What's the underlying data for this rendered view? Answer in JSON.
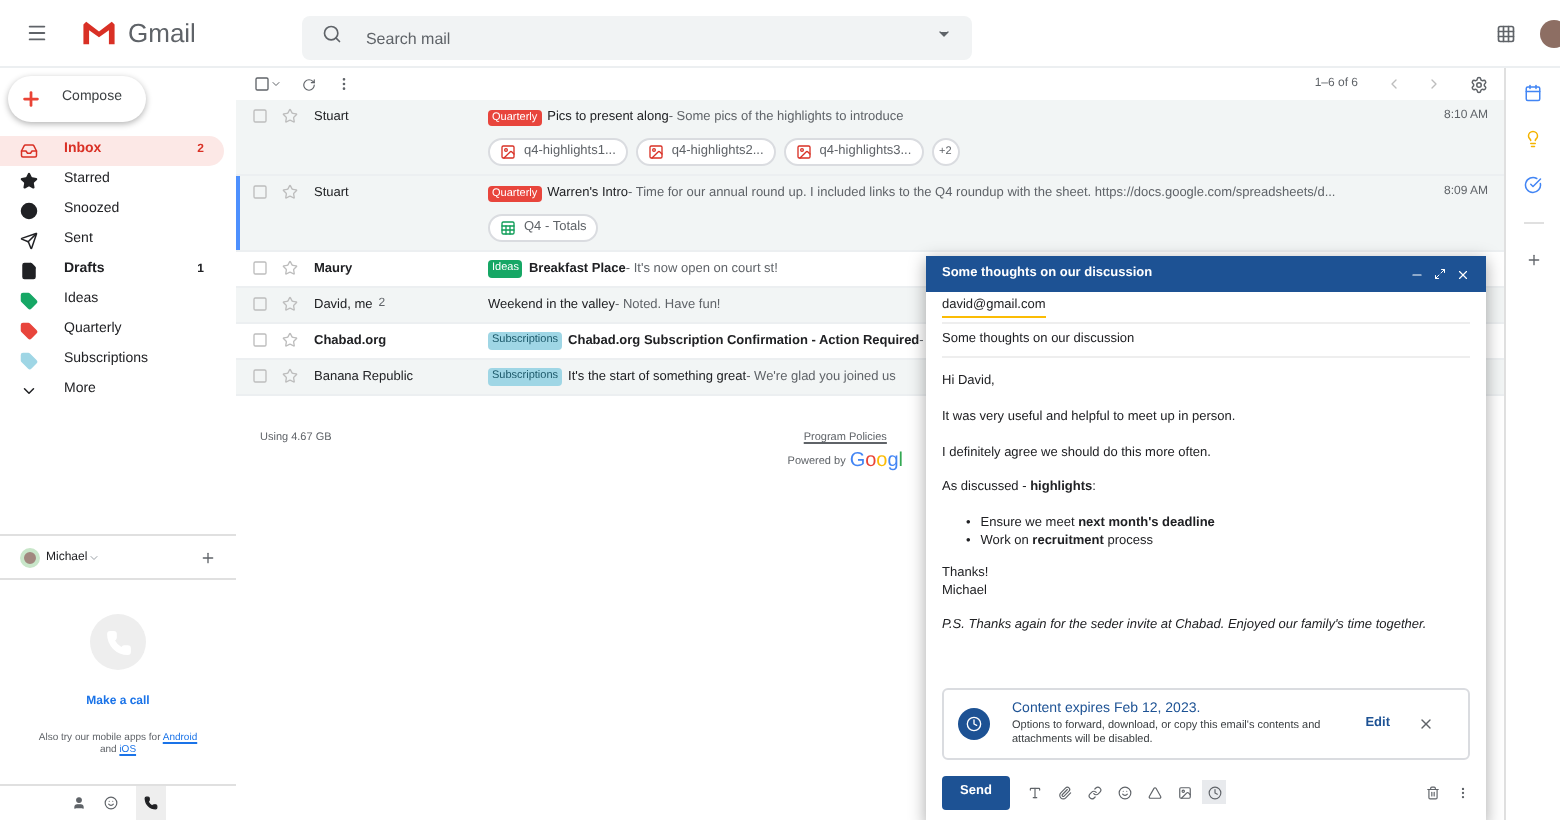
{
  "header": {
    "app_name": "Gmail",
    "search": {
      "placeholder": "Search mail"
    }
  },
  "sidebar": {
    "compose": "Compose",
    "items": [
      {
        "label": "Inbox",
        "count": "2",
        "selected": true,
        "bold": true
      },
      {
        "label": "Starred",
        "selected": false,
        "bold": false
      },
      {
        "label": "Snoozed",
        "selected": false,
        "bold": false
      },
      {
        "label": "Sent",
        "selected": false,
        "bold": false
      },
      {
        "label": "Drafts",
        "count": "1",
        "selected": false,
        "bold": true
      },
      {
        "label": "Ideas",
        "color": "#16a765",
        "selected": false,
        "bold": false
      },
      {
        "label": "Quarterly",
        "color": "#e8453c",
        "selected": false,
        "bold": false
      },
      {
        "label": "Subscriptions",
        "color": "#9fd6e5",
        "selected": false,
        "bold": false
      },
      {
        "label": "More",
        "selected": false,
        "bold": false
      }
    ]
  },
  "hangouts": {
    "user": "Michael",
    "make_call": "Make a call",
    "promo_text": "Also try our mobile apps for",
    "android": "Android",
    "and": "and",
    "ios": "iOS"
  },
  "toolbar": {
    "select_all": {
      "checked": false
    },
    "pagination": "1–6 of 6"
  },
  "emails": [
    {
      "sender": "Stuart",
      "unread": false,
      "focused": false,
      "label": {
        "text": "Quarterly",
        "color": "#e8453c"
      },
      "subject": "Pics to present along",
      "snippet": " - Some pics of the highlights to introduce",
      "time": "8:10 AM",
      "attachments": [
        {
          "kind": "image",
          "name": "q4-highlights1..."
        },
        {
          "kind": "image",
          "name": "q4-highlights2..."
        },
        {
          "kind": "image",
          "name": "q4-highlights3..."
        }
      ],
      "more_attachments": "+2"
    },
    {
      "sender": "Stuart",
      "unread": false,
      "focused": true,
      "label": {
        "text": "Quarterly",
        "color": "#e8453c"
      },
      "subject": "Warren's Intro",
      "snippet": " - Time for our annual round up. I included links to the Q4 roundup with the sheet. https://docs.google.com/spreadsheets/d...",
      "time": "8:09 AM",
      "attachments": [
        {
          "kind": "sheet",
          "name": "Q4 - Totals"
        }
      ]
    },
    {
      "sender": "Maury",
      "unread": true,
      "focused": false,
      "label": {
        "text": "Ideas",
        "color": "#16a765"
      },
      "subject": "Breakfast Place",
      "snippet": " - It's now open on court st!"
    },
    {
      "sender": "David, me",
      "thread_count": "2",
      "unread": false,
      "focused": false,
      "subject": "Weekend in the valley",
      "snippet": " - Noted. Have fun!"
    },
    {
      "sender": "Chabad.org",
      "unread": true,
      "focused": false,
      "label": {
        "text": "Subscriptions",
        "color": "#9fd6e5"
      },
      "subject": "Chabad.org Subscription Confirmation - Action Required",
      "snippet": " -"
    },
    {
      "sender": "Banana Republic",
      "unread": false,
      "focused": false,
      "label": {
        "text": "Subscriptions",
        "color": "#9fd6e5"
      },
      "subject": "It's the start of something great",
      "snippet": " - We're glad you joined us"
    }
  ],
  "footer": {
    "storage": "Using 4.67 GB",
    "policies": "Program Policies",
    "powered_by": "Powered by",
    "google": "Googl"
  },
  "compose": {
    "title": "Some thoughts on our discussion",
    "to": "david@gmail.com",
    "subject": "Some thoughts on our discussion",
    "body": [
      {
        "kind": "text",
        "text": "Hi David,"
      },
      {
        "kind": "text",
        "text": "It was very useful and helpful to meet up in person."
      },
      {
        "kind": "text",
        "text": "I definitely agree we should do this more often."
      },
      {
        "kind": "text",
        "text": "As discussed - **highlights**:"
      },
      {
        "kind": "bullets",
        "items": [
          {
            "marker": "•",
            "text": "Ensure we meet **next month's deadline**"
          },
          {
            "marker": "•",
            "text": "Work on **recruitment** process"
          }
        ]
      },
      {
        "kind": "lines",
        "items": [
          "Thanks!",
          "Michael"
        ]
      },
      {
        "kind": "note",
        "text": "P.S. Thanks again for the seder invite at Chabad. Enjoyed our family's time together."
      }
    ],
    "confidential": {
      "title": "Content expires Feb 12, 2023.",
      "text": "Options to forward, download, or copy this email's contents and attachments will be disabled.",
      "edit": "Edit"
    },
    "send": "Send"
  }
}
